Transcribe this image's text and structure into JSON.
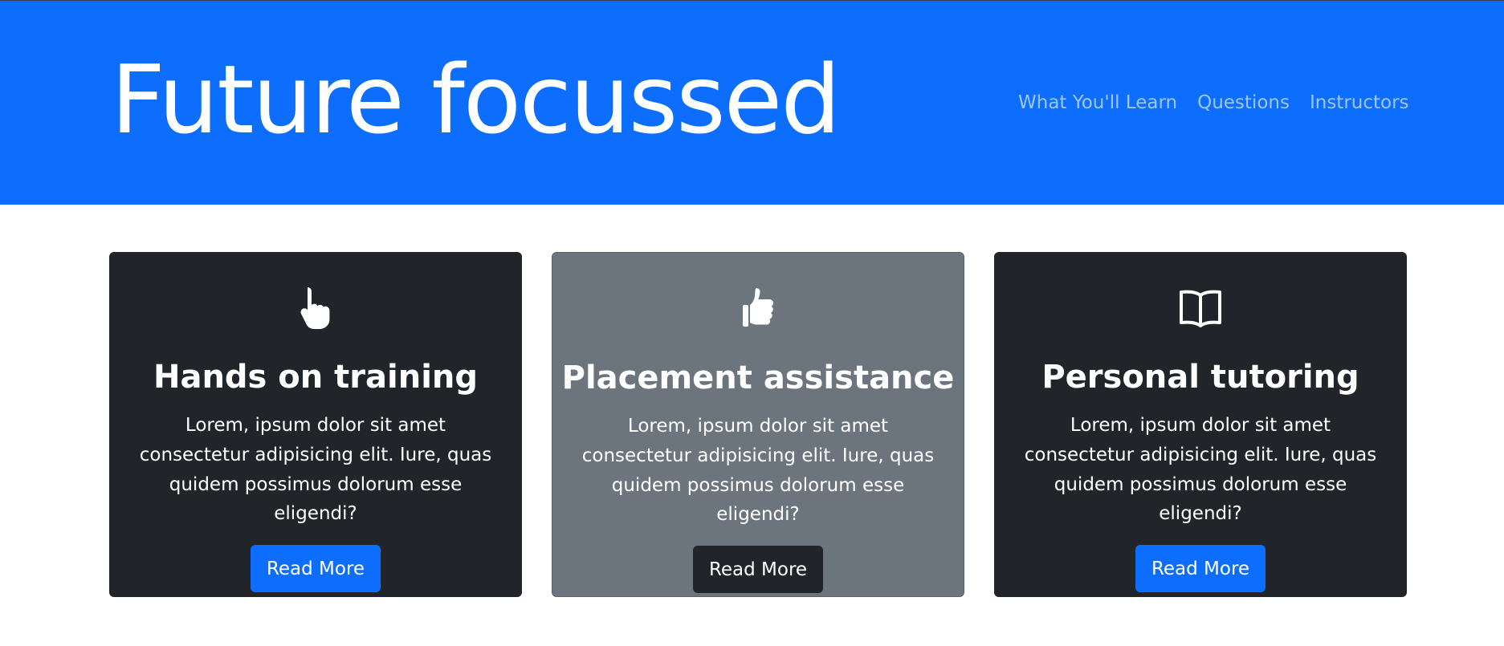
{
  "header": {
    "title": "Future focussed",
    "nav": [
      "What You'll Learn",
      "Questions",
      "Instructors"
    ]
  },
  "cards": [
    {
      "icon": "pointing-hand-icon",
      "title": "Hands on training",
      "text": "Lorem, ipsum dolor sit amet consectetur adipisicing elit. Iure, quas quidem possimus dolorum esse eligendi?",
      "button": "Read More",
      "bg": "#212529",
      "button_color": "#0d6efd"
    },
    {
      "icon": "thumbs-up-icon",
      "title": "Placement assistance",
      "text": "Lorem, ipsum dolor sit amet consectetur adipisicing elit. Iure, quas quidem possimus dolorum esse eligendi?",
      "button": "Read More",
      "bg": "#6c757d",
      "button_color": "#212529"
    },
    {
      "icon": "open-book-icon",
      "title": "Personal tutoring",
      "text": "Lorem, ipsum dolor sit amet consectetur adipisicing elit. Iure, quas quidem possimus dolorum esse eligendi?",
      "button": "Read More",
      "bg": "#212529",
      "button_color": "#0d6efd"
    }
  ],
  "colors": {
    "primary": "#0d6efd",
    "dark": "#212529",
    "secondary": "#6c757d"
  }
}
